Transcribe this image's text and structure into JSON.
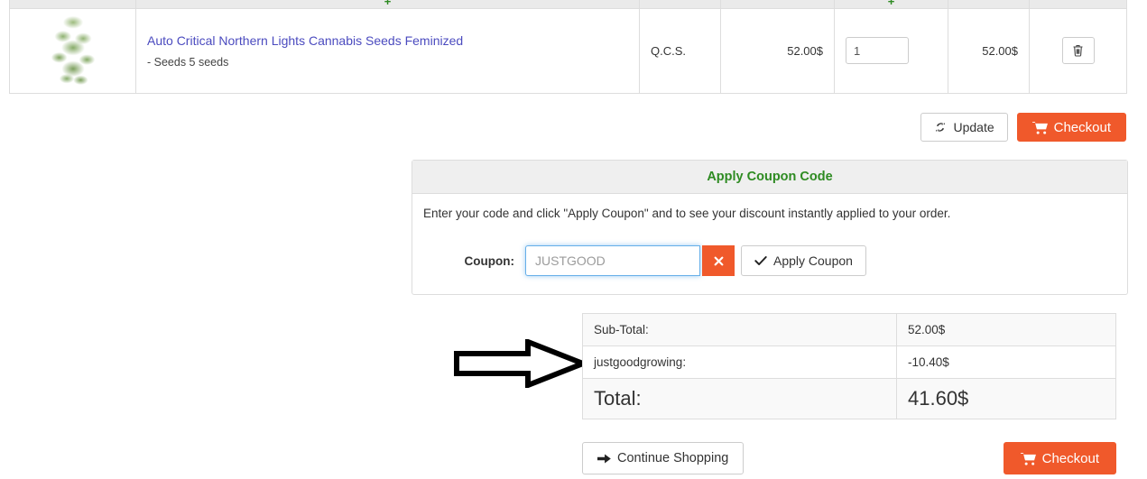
{
  "cart_table": {
    "columns": [
      {
        "key": "image",
        "label": ""
      },
      {
        "key": "name",
        "label": ""
      },
      {
        "key": "model",
        "label": ""
      },
      {
        "key": "price",
        "label": ""
      },
      {
        "key": "qty",
        "label": ""
      },
      {
        "key": "total",
        "label": ""
      },
      {
        "key": "action",
        "label": ""
      }
    ],
    "header_clipped_left": "+",
    "header_clipped_right": "+",
    "rows": [
      {
        "image_alt": "cannabis-plant-thumbnail",
        "product_name": "Auto Critical Northern Lights Cannabis Seeds Feminized",
        "option": "- Seeds 5 seeds",
        "model": "Q.C.S.",
        "unit_price": "52.00$",
        "quantity": "1",
        "line_total": "52.00$",
        "remove_icon": "trash-icon"
      }
    ]
  },
  "cart_actions": {
    "update_label": "Update",
    "update_icon": "refresh-icon",
    "checkout_label": "Checkout",
    "checkout_icon": "cart-icon"
  },
  "coupon": {
    "title": "Apply Coupon Code",
    "description": "Enter your code and click \"Apply Coupon\" and to see your discount instantly applied to your order.",
    "field_label": "Coupon:",
    "value": "JUSTGOOD",
    "placeholder": "JUSTGOOD",
    "clear_icon": "close-x-icon",
    "clear_label": "✖",
    "apply_label": "Apply Coupon",
    "apply_icon": "check-icon"
  },
  "totals": {
    "rows": [
      {
        "label": "Sub-Total:",
        "value": "52.00$"
      },
      {
        "label": "justgoodgrowing:",
        "value": "-10.40$"
      }
    ],
    "grand": {
      "label": "Total:",
      "value": "41.60$"
    }
  },
  "bottom_actions": {
    "continue_label": "Continue Shopping",
    "continue_icon": "arrow-right-icon",
    "checkout_label": "Checkout",
    "checkout_icon": "cart-icon"
  },
  "annotation": {
    "arrow_icon": "block-arrow-right-annotation",
    "points_to": "justgoodgrowing:"
  },
  "colors": {
    "accent_orange": "#f0592b",
    "heading_green": "#2e8b22",
    "link_blue": "#4b4bbf",
    "border_gray": "#dddddd",
    "header_bg": "#eaeaea",
    "focus_blue": "#66afe9"
  }
}
